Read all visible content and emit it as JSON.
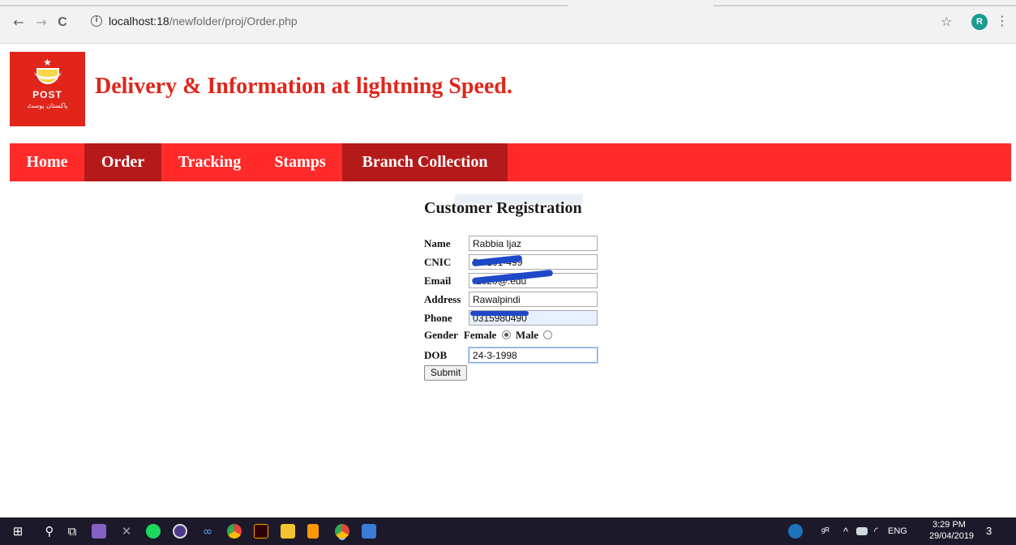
{
  "browser": {
    "back": "←",
    "forward": "→",
    "reload": "C",
    "info": "i",
    "url_host": "localhost:18",
    "url_path": "/newfolder/proj/Order.php",
    "star": "☆",
    "profile_initial": "R",
    "menu": "⋮"
  },
  "header": {
    "logo_star": "★",
    "logo_text": "POST",
    "logo_urdu": "پاکستان پوسٹ",
    "title": "Delivery & Information at lightning Speed."
  },
  "nav": {
    "items": [
      {
        "label": "Home"
      },
      {
        "label": "Order"
      },
      {
        "label": "Tracking"
      },
      {
        "label": "Stamps"
      },
      {
        "label": "Branch Collection"
      }
    ],
    "active": "Order"
  },
  "form": {
    "title": "Customer Registration",
    "fields": {
      "name": {
        "label": "Name",
        "value": "Rabbia Ijaz"
      },
      "cnic": {
        "label": "CNIC",
        "value": "3-4101-499"
      },
      "email": {
        "label": "Email",
        "value": "r1020@.edu"
      },
      "address": {
        "label": "Address",
        "value": "Rawalpindi"
      },
      "phone": {
        "label": "Phone",
        "value": "0315980490"
      },
      "dob": {
        "label": "DOB",
        "value": "24-3-1998"
      }
    },
    "gender": {
      "label": "Gender",
      "female": "Female",
      "male": "Male",
      "selected": "Female"
    },
    "submit_label": "Submit"
  },
  "taskbar": {
    "start": "⊞",
    "search": "⚲",
    "taskview": "⧉",
    "apps": [
      "visual-studio",
      "tool",
      "spotify",
      "eclipse",
      "infinity",
      "chrome",
      "illustrator",
      "file-explorer",
      "sublime-text",
      "chrome-active",
      "window"
    ],
    "tray": {
      "people": "ᵍᴿ",
      "chevron": "^",
      "lang": "ENG",
      "time": "3:29 PM",
      "date": "29/04/2019",
      "notifications": "3"
    }
  },
  "colors": {
    "brand_red": "#e1251b",
    "nav_red": "#ff2a2a",
    "nav_active": "#b51a1a",
    "redaction_blue": "#1e48c8"
  }
}
